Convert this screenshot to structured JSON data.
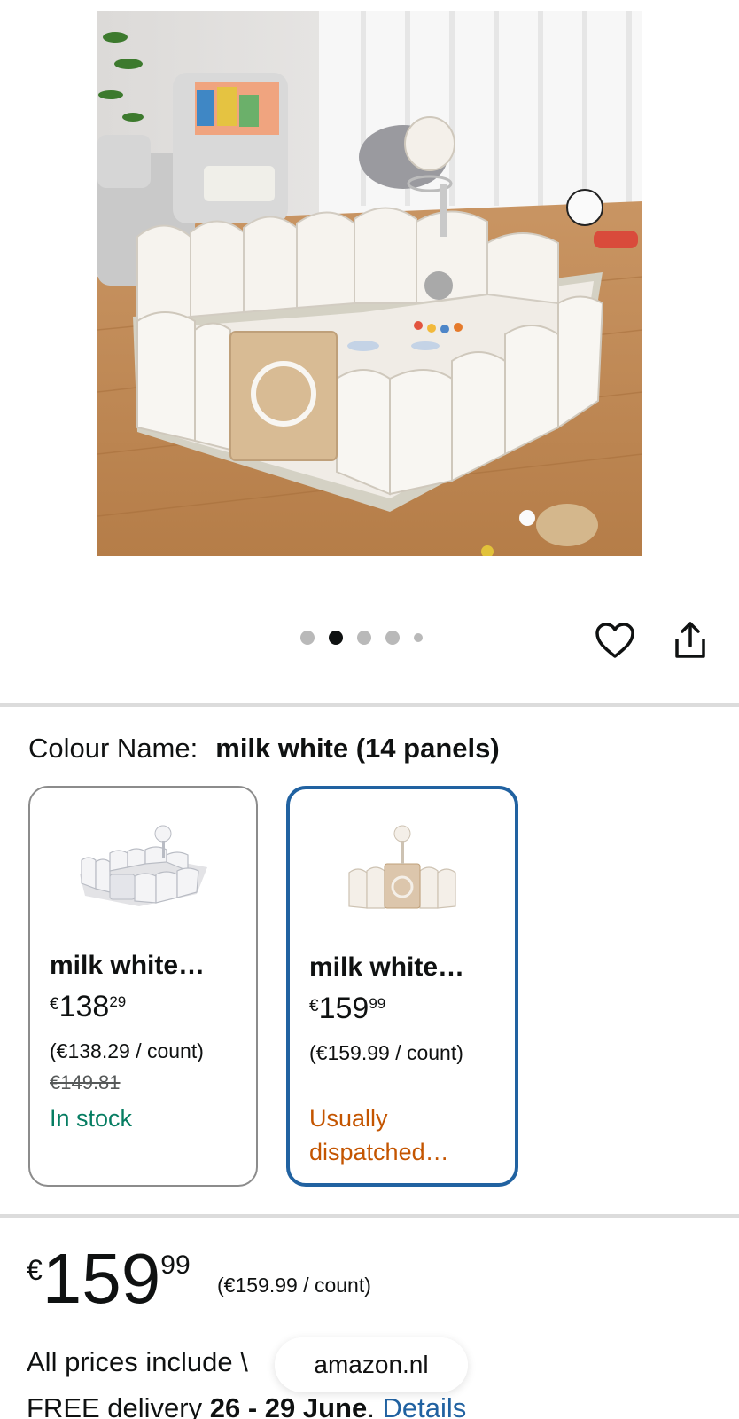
{
  "carousel": {
    "dot_count": 5,
    "active_index": 1
  },
  "icons": {
    "wishlist": "heart-icon",
    "share": "share-icon"
  },
  "colour": {
    "label": "Colour Name:",
    "value": "milk white (14 panels)"
  },
  "variants": [
    {
      "title": "milk white…",
      "currency": "€",
      "price_whole": "138",
      "price_fraction": "29",
      "unit_price": "(€138.29 / count)",
      "was_price": "€149.81",
      "availability": "In stock",
      "selected": false
    },
    {
      "title": "milk white…",
      "currency": "€",
      "price_whole": "159",
      "price_fraction": "99",
      "unit_price": "(€159.99 / count)",
      "availability": "Usually dispatched…",
      "selected": true
    }
  ],
  "price": {
    "currency": "€",
    "whole": "159",
    "fraction": "99",
    "unit": "(€159.99 / count)"
  },
  "vat_text": "All prices include \\",
  "delivery": {
    "prefix": "FREE delivery",
    "dates": "26 - 29 June",
    "separator": ".",
    "link": "Details"
  },
  "url_bar": {
    "domain": "amazon.nl"
  },
  "colors": {
    "accent_link": "#2162a1",
    "in_stock": "#067d62",
    "dispatch": "#c45500",
    "selected_border": "#2162a1"
  }
}
